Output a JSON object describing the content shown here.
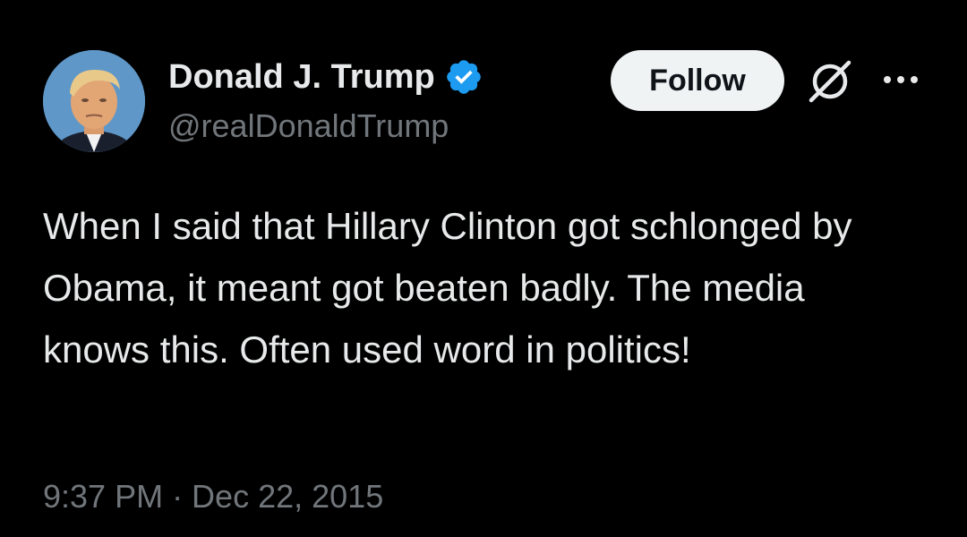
{
  "author": {
    "display_name": "Donald J. Trump",
    "handle": "@realDonaldTrump",
    "verified": true,
    "avatar_icon": "profile-photo"
  },
  "actions": {
    "follow_label": "Follow",
    "grok_icon": "grok-icon",
    "more_icon": "more-dots-icon"
  },
  "tweet": {
    "text": "When I said that Hillary Clinton got schlonged by Obama, it meant got beaten badly. The media knows this. Often used word in politics!",
    "timestamp": "9:37 PM · Dec 22, 2015"
  },
  "colors": {
    "background": "#000000",
    "primary_text": "#e7e9ea",
    "secondary_text": "#71767b",
    "verified_badge": "#1d9bf0",
    "follow_bg": "#eff3f4"
  }
}
